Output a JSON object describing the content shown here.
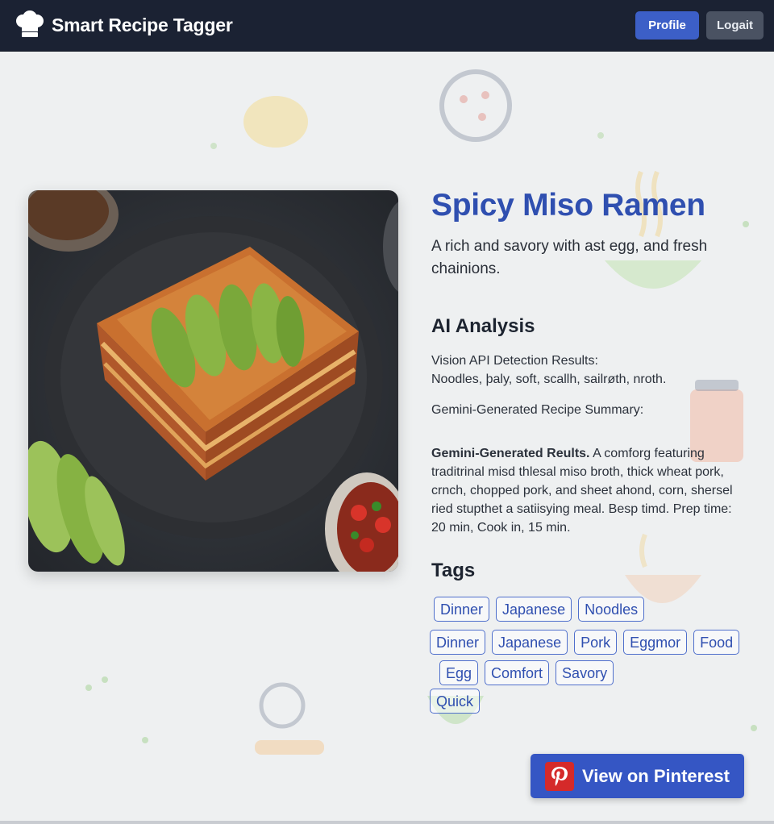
{
  "header": {
    "app_title": "Smart Recipe Tagger",
    "profile_label": "Profile",
    "logout_label": "Logait",
    "logo_icon": "chef-hat-icon"
  },
  "recipe": {
    "title": "Spicy Miso Ramen",
    "description": "A rich and savory with ast egg, and fresh chainions.",
    "image_description_icon": "recipe-photo"
  },
  "analysis": {
    "heading": "AI Analysis",
    "vision_label": "Vision API Detection Results:",
    "vision_results": "Noodles, þaly, soft, scallh, sailrøth, nroth.",
    "summary_label": "Gemini-Generated Recipe Summary:",
    "results_lead": "Gemini-Generated Reults.",
    "results_text": " A comforg featuring traditrinal misd thlesal miso broth, thick wheat pork, crnch, chopped pork, and sheet ahond, corn, shersel ried stupthet a satiisying meal. Besp timd. Prep time: 20 min, Cook in, 15 min."
  },
  "tags": {
    "heading": "Tags",
    "row1": [
      "Dinner",
      "Japanese",
      "Noodles"
    ],
    "row2": [
      "Dinner",
      "Japanese",
      "Pork",
      "Eggmor",
      "Food"
    ],
    "row3": [
      "Egg",
      "Comfort",
      "Savory"
    ],
    "row4": [
      "Quick"
    ]
  },
  "pinterest": {
    "label": "View on Pinterest",
    "icon": "pinterest-icon",
    "brand_color": "#d52a2a"
  },
  "colors": {
    "navbar": "#1b2233",
    "accent": "#3c5fc7",
    "title": "#2f4fb0"
  }
}
